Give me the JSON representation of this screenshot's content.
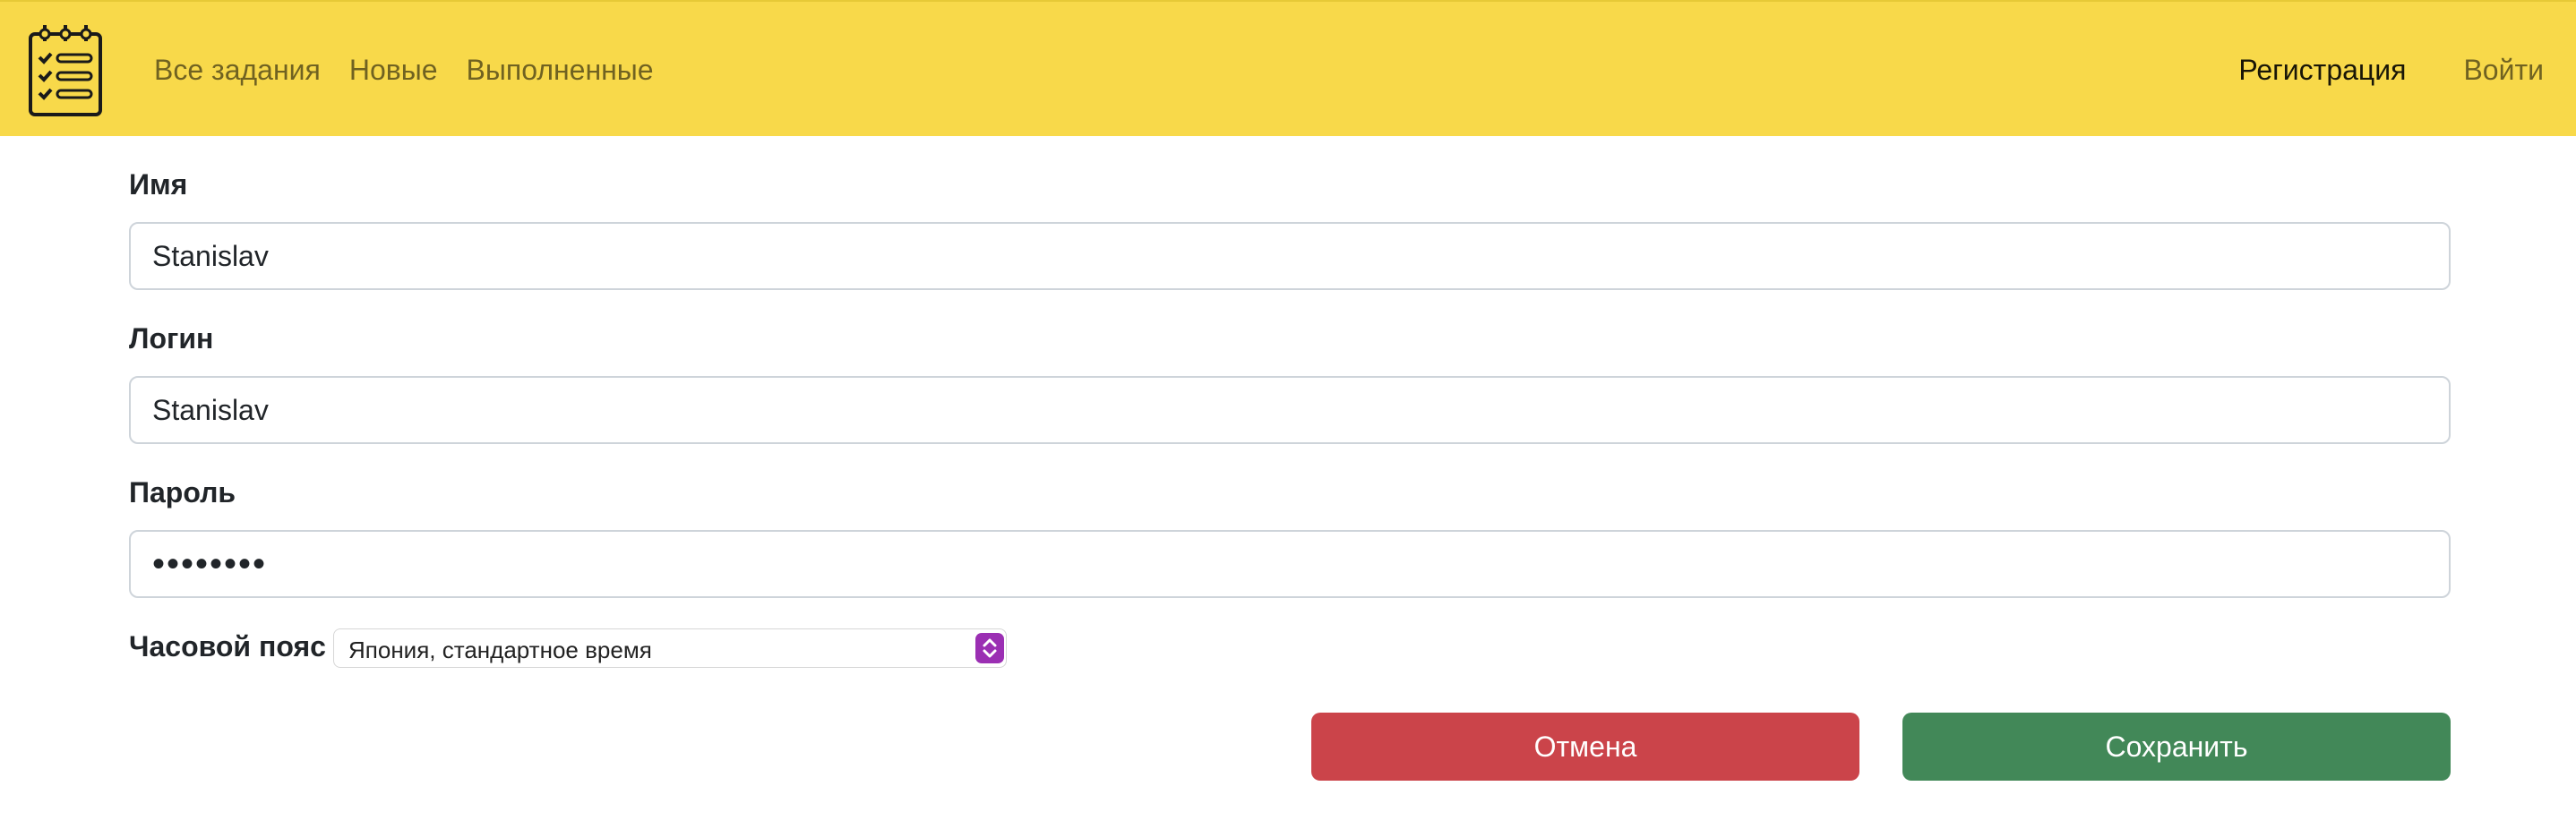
{
  "navbar": {
    "background": "#f8d94a",
    "logo_icon": "checklist-notepad-icon",
    "left_links": [
      "Все задания",
      "Новые",
      "Выполненные"
    ],
    "right_links": {
      "register": "Регистрация",
      "login": "Войти"
    }
  },
  "form": {
    "name": {
      "label": "Имя",
      "value": "Stanislav"
    },
    "login": {
      "label": "Логин",
      "value": "Stanislav"
    },
    "password": {
      "label": "Пароль",
      "value": "••••••••"
    },
    "timezone": {
      "label": "Часовой пояс",
      "selected": "Япония, стандартное время",
      "arrow_icon": "select-updown-icon",
      "arrow_color": "#9b2fb3"
    }
  },
  "buttons": {
    "cancel": "Отмена",
    "save": "Сохранить",
    "cancel_color": "#cb444a",
    "save_color": "#428858"
  }
}
